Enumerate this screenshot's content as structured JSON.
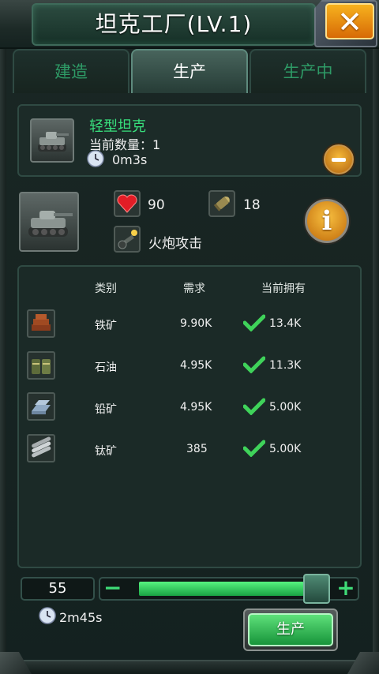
{
  "title": "坦克工厂(LV.1)",
  "close_icon": "close-icon",
  "tabs": [
    {
      "label": "建造",
      "active": false
    },
    {
      "label": "生产",
      "active": true
    },
    {
      "label": "生产中",
      "active": false
    }
  ],
  "queue_item": {
    "name": "轻型坦克",
    "count_line": "当前数量：1",
    "time": "0m3s",
    "thumb_icon": "light-tank-icon",
    "remove_icon": "minus-circle-icon"
  },
  "unit_stats": {
    "thumb_icon": "light-tank-icon",
    "hp": "90",
    "hp_icon": "heart-icon",
    "attack": "18",
    "attack_icon": "shell-icon",
    "attack_type": "火炮攻击",
    "attack_type_icon": "cannon-icon",
    "info_icon": "info-icon"
  },
  "requirements": {
    "headers": {
      "type": "类别",
      "need": "需求",
      "have": "当前拥有"
    },
    "rows": [
      {
        "icon": "iron-ore-icon",
        "type": "铁矿",
        "need": "9.90K",
        "have": "13.4K"
      },
      {
        "icon": "oil-icon",
        "type": "石油",
        "need": "4.95K",
        "have": "11.3K"
      },
      {
        "icon": "lead-ore-icon",
        "type": "铅矿",
        "need": "4.95K",
        "have": "5.00K"
      },
      {
        "icon": "titanium-ore-icon",
        "type": "钛矿",
        "need": "385",
        "have": "5.00K"
      }
    ]
  },
  "quantity": {
    "value": "55",
    "slider_level": 0.94,
    "minus_label": "−",
    "plus_label": "+"
  },
  "total_time": "2m45s",
  "produce_button": "生产",
  "colors": {
    "accent_green": "#38e07d",
    "check_green": "#3fd35a",
    "button_orange": "#e88f1a"
  }
}
